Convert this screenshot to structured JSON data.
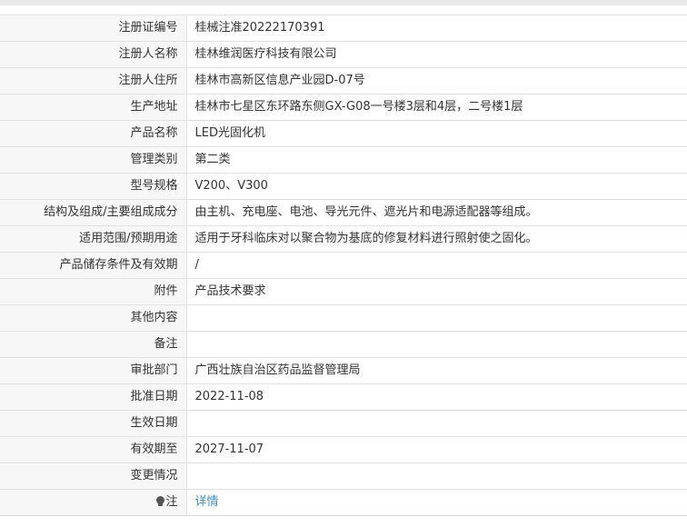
{
  "rows": [
    {
      "label": "注册证编号",
      "value": "桂械注准20222170391"
    },
    {
      "label": "注册人名称",
      "value": "桂林维润医疗科技有限公司"
    },
    {
      "label": "注册人住所",
      "value": "桂林市高新区信息产业园D-07号"
    },
    {
      "label": "生产地址",
      "value": "桂林市七星区东环路东侧GX-G08一号楼3层和4层，二号楼1层"
    },
    {
      "label": "产品名称",
      "value": "LED光固化机"
    },
    {
      "label": "管理类别",
      "value": "第二类"
    },
    {
      "label": "型号规格",
      "value": "V200、V300"
    },
    {
      "label": "结构及组成/主要组成成分",
      "value": "由主机、充电座、电池、导光元件、遮光片和电源适配器等组成。"
    },
    {
      "label": "适用范围/预期用途",
      "value": "适用于牙科临床对以聚合物为基底的修复材料进行照射使之固化。"
    },
    {
      "label": "产品储存条件及有效期",
      "value": "/"
    },
    {
      "label": "附件",
      "value": "产品技术要求"
    },
    {
      "label": "其他内容",
      "value": ""
    },
    {
      "label": "备注",
      "value": ""
    },
    {
      "label": "审批部门",
      "value": "广西壮族自治区药品监督管理局"
    },
    {
      "label": "批准日期",
      "value": "2022-11-08"
    },
    {
      "label": "生效日期",
      "value": ""
    },
    {
      "label": "有效期至",
      "value": "2027-11-07"
    },
    {
      "label": "变更情况",
      "value": ""
    }
  ],
  "note_row": {
    "icon": "lightbulb-icon",
    "label": "注",
    "link_text": "详情"
  },
  "colors": {
    "label_bg": "#f7f7f7",
    "border": "#e2e2e2",
    "link": "#3b8fd6",
    "text": "#333333"
  }
}
